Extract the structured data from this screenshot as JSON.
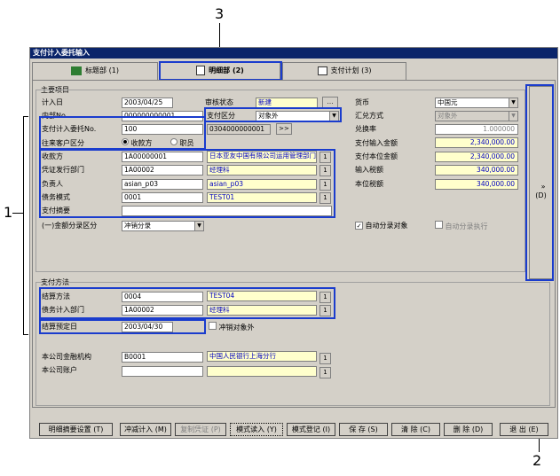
{
  "window_title": "支付计入委托输入",
  "callouts": {
    "one": "1",
    "two": "2",
    "three": "3"
  },
  "tabs": [
    {
      "label": "标题部 (1)"
    },
    {
      "label": "明细部 (2)"
    },
    {
      "label": "支付计划 (3)"
    }
  ],
  "main_group": {
    "title": "主要项目"
  },
  "fields": {
    "entry_date_label": "计入日",
    "entry_date": "2003/04/25",
    "slip_no_label": "内部No.",
    "slip_no": "000000000001",
    "review_status_label": "审核状态",
    "review_status": "新建",
    "more_btn": "…",
    "payment_class_label": "支付区分",
    "payment_class": "对象外",
    "request_no_label": "支付计入委托No.",
    "request_no": "100",
    "request_no2": "0304000000001",
    "jump_btn": ">>",
    "client_class_label": "往来客户区分",
    "radio_payee": "收款方",
    "radio_staff": "职员",
    "payee_label": "收款方",
    "payee_code": "1A00000001",
    "payee_name": "日本亚友中国有限公司运用管理部门",
    "dept_label": "凭证发行部门",
    "dept_code": "1A00002",
    "dept_name": "经理科",
    "owner_label": "负责人",
    "owner_code": "asian_p03",
    "owner_name": "asian_p03",
    "debt_label": "债务模式",
    "debt_code": "0001",
    "debt_name": "TEST01",
    "summary_label": "支付摘要",
    "summary": "",
    "amount_class_label": "(一)金额分录区分",
    "amount_class": "冲销分录",
    "currency_label": "货币",
    "currency": "中国元",
    "summary_method_label": "汇兑方式",
    "summary_method": "对象外",
    "rate_label": "兑换率",
    "rate": "1.000000",
    "pay_amount_label": "支付输入金额",
    "pay_amount": "2,340,000.00",
    "base_amount_label": "支付本位金额",
    "base_amount": "2,340,000.00",
    "input_tax_label": "输入税额",
    "input_tax": "340,000.00",
    "base_tax_label": "本位税额",
    "base_tax": "340,000.00",
    "auto_entry_label": "自动分录对象",
    "auto_exec_label": "自动分录执行",
    "side_btn": "»\n(D)",
    "lookup_btn": "1"
  },
  "payment_group": {
    "title": "支付方法",
    "settle_method_label": "结算方法",
    "settle_method_code": "0004",
    "settle_method_name": "TEST04",
    "debt_dept_label": "债务计入部门",
    "debt_dept_code": "1A00002",
    "debt_dept_name": "经理科",
    "settle_date_label": "结算预定日",
    "settle_date": "2003/04/30",
    "offset_label": "冲销对象外",
    "bank_label": "本公司金融机构",
    "bank_code": "B0001",
    "bank_name": "中国人民银行上海分行",
    "account_label": "本公司账户",
    "account_code": "",
    "account_name": ""
  },
  "buttons": [
    {
      "label": "明细摘要设置 (T)",
      "disabled": false
    },
    {
      "label": "冲减计入 (M)",
      "disabled": false
    },
    {
      "label": "复制凭证 (P)",
      "disabled": true
    },
    {
      "label": "模式读入 (Y)",
      "disabled": false
    },
    {
      "label": "模式登记 (I)",
      "disabled": false
    },
    {
      "label": "保 存 (S)",
      "disabled": false
    },
    {
      "label": "清 除 (C)",
      "disabled": false
    },
    {
      "label": "删 除 (D)",
      "disabled": false
    },
    {
      "label": "退 出 (E)",
      "disabled": false
    }
  ]
}
